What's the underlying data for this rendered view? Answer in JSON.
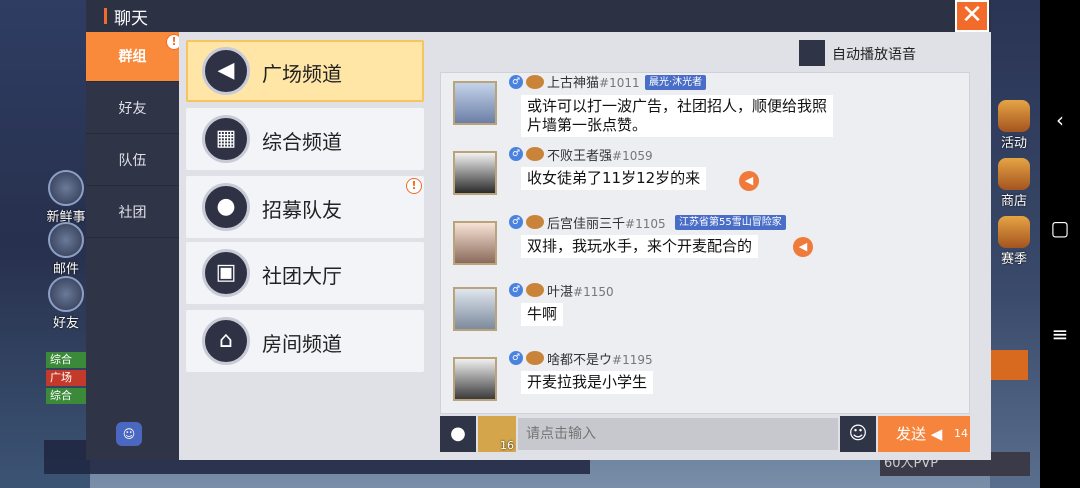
{
  "window": {
    "title": "聊天"
  },
  "tabs": [
    {
      "label": "群组",
      "active": true
    },
    {
      "label": "好友"
    },
    {
      "label": "队伍"
    },
    {
      "label": "社团"
    }
  ],
  "channels": [
    {
      "label": "广场频道",
      "icon": "speaker-icon",
      "active": true
    },
    {
      "label": "综合频道",
      "icon": "grid-icon"
    },
    {
      "label": "招募队友",
      "icon": "people-icon",
      "alert": true
    },
    {
      "label": "社团大厅",
      "icon": "banner-icon"
    },
    {
      "label": "房间频道",
      "icon": "home-icon"
    }
  ],
  "autoplay": {
    "label": "自动播放语音"
  },
  "messages": [
    {
      "name": "上古神猫",
      "num": "#1011",
      "badge": "晨光·沐光者",
      "text_line1": "或许可以打一波广告，社团招人，顺便给我照",
      "text_line2": "片墙第一张点赞。"
    },
    {
      "name": "不败王者强",
      "num": "#1059",
      "text": "收女徒弟了11岁12岁的来"
    },
    {
      "name": "后宫佳丽三千",
      "num": "#1105",
      "badge": "江苏省第55雪山冒险家",
      "text": "双排，我玩水手，来个开麦配合的"
    },
    {
      "name": "叶湛",
      "num": "#1150",
      "text": "牛啊"
    },
    {
      "name": "啥都不是ウ",
      "num": "#1195",
      "text": "开麦拉我是小学生"
    }
  ],
  "input": {
    "placeholder": "请点击输入",
    "horn_count": "16"
  },
  "send": {
    "label": "发送",
    "count": "14"
  },
  "game": {
    "left_icons": [
      "新鲜事",
      "邮件",
      "好友"
    ],
    "mini_chat": [
      "综合",
      "广场",
      "综合"
    ],
    "right_icons": [
      "活动",
      "商店",
      "赛季"
    ],
    "pvp_label": "60人PVP"
  },
  "colors": {
    "accent": "#f7843c",
    "tab_active": "#f98a3c",
    "dark": "#2f3447"
  }
}
